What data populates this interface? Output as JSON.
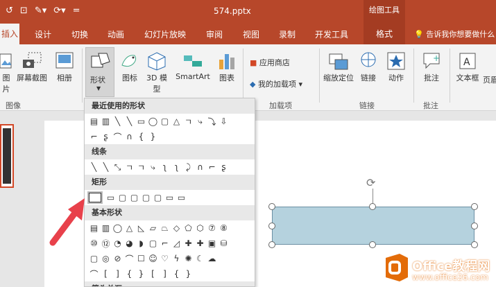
{
  "titlebar": {
    "file_name": "574.pptx",
    "context_tab": "绘图工具",
    "qat_icons": [
      "undo-icon",
      "present-icon",
      "theme-icon",
      "customize-icon"
    ],
    "qat_glyphs": [
      "↺",
      "⊡",
      "✎▾",
      "⟳▾",
      "="
    ]
  },
  "tabs": {
    "insert": "插入",
    "items": [
      "设计",
      "切换",
      "动画",
      "幻灯片放映",
      "审阅",
      "视图",
      "录制",
      "开发工具"
    ],
    "format": "格式",
    "tellme": "告诉我你想要做什么"
  },
  "ribbon": {
    "image_group": {
      "pic": "图片",
      "screenshot": "屏幕截图",
      "album": "相册",
      "label": "图像"
    },
    "illus_group": {
      "shapes": "形状",
      "icons": "图标",
      "model3d": "3D 模型",
      "smartart": "SmartArt",
      "chart": "图表"
    },
    "addins_group": {
      "store": "应用商店",
      "myaddins": "我的加载项",
      "label": "加载项"
    },
    "links_group": {
      "zoom": "缩放定位",
      "link": "链接",
      "action": "动作",
      "label": "链接"
    },
    "comments_group": {
      "comment": "批注",
      "label": "批注"
    },
    "text_group": {
      "textbox": "文本框",
      "header": "页眉"
    }
  },
  "gallery": {
    "recent_title": "最近使用的形状",
    "lines_title": "线条",
    "rect_title": "矩形",
    "basic_title": "基本形状",
    "arrows_title": "箭头总汇",
    "recent_row1": [
      "▤",
      "▥",
      "╲",
      "╲",
      "▭",
      "◯",
      "▢",
      "△",
      "ㄱ",
      "⤷",
      "⤵",
      "⇩"
    ],
    "recent_row2": [
      "⌐",
      "ʂ",
      "⌒",
      "∩",
      "{",
      "}"
    ],
    "lines_row": [
      "╲",
      "╲",
      "⤡",
      "ㄱ",
      "ㄱ",
      "⤷",
      "ʅ",
      "ʅ",
      "⤸",
      "∩",
      "⌐",
      "ʂ"
    ],
    "rect_row": [
      "▭",
      "▢",
      "▢",
      "▢",
      "▢",
      "▭",
      "▭"
    ],
    "basic_row1": [
      "▤",
      "▥",
      "◯",
      "△",
      "◺",
      "▱",
      "⏢",
      "◇",
      "⬠",
      "⬡",
      "⑦",
      "⑧"
    ],
    "basic_row2": [
      "⑩",
      "⑫",
      "◔",
      "◕",
      "◗",
      "▢",
      "⌐",
      "◿",
      "✚",
      "✚",
      "▣",
      "⛁"
    ],
    "basic_row3": [
      "▢",
      "◎",
      "⊘",
      "⌒",
      "☐",
      "☺",
      "♡",
      "ϟ",
      "✺",
      "☾",
      "☁"
    ],
    "basic_row4": [
      "⌒",
      "[",
      "]",
      "{",
      "}",
      "[",
      "]",
      "{",
      "}"
    ]
  },
  "watermark": {
    "brand": "Office教程网",
    "url": "www.office26.com"
  },
  "colors": {
    "accent": "#b7472a",
    "shape_fill": "#b5d2de",
    "arrow": "#e8414b"
  }
}
